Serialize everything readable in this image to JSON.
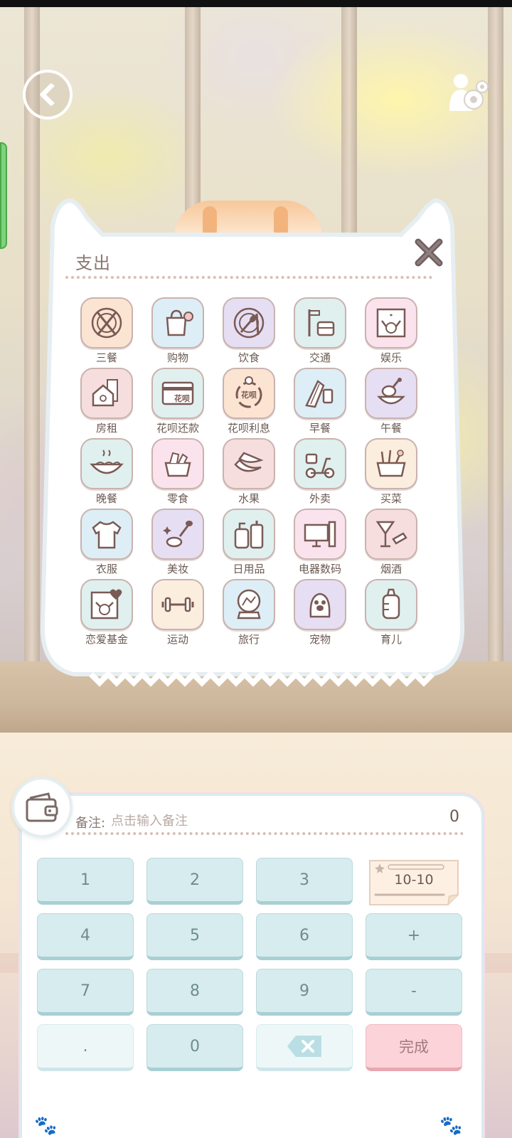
{
  "panel": {
    "title": "支出",
    "categories": [
      {
        "label": "三餐",
        "icon": "plate-fork-knife-icon",
        "color": "peach"
      },
      {
        "label": "购物",
        "icon": "shopping-bag-icon",
        "color": "blue"
      },
      {
        "label": "饮食",
        "icon": "plate-spoon-icon",
        "color": "lav"
      },
      {
        "label": "交通",
        "icon": "bus-stop-icon",
        "color": "mint"
      },
      {
        "label": "娱乐",
        "icon": "duck-picture-icon",
        "color": "pink"
      },
      {
        "label": "房租",
        "icon": "house-icon",
        "color": "rose"
      },
      {
        "label": "花呗还款",
        "icon": "credit-card-icon",
        "color": "mint",
        "text": "花呗"
      },
      {
        "label": "花呗利息",
        "icon": "interest-cycle-icon",
        "color": "peach",
        "text": "花呗"
      },
      {
        "label": "早餐",
        "icon": "sandwich-icon",
        "color": "blue"
      },
      {
        "label": "午餐",
        "icon": "drumstick-icon",
        "color": "lav"
      },
      {
        "label": "晚餐",
        "icon": "noodle-bowl-icon",
        "color": "mint"
      },
      {
        "label": "零食",
        "icon": "snack-basket-icon",
        "color": "pink"
      },
      {
        "label": "水果",
        "icon": "banana-icon",
        "color": "rose"
      },
      {
        "label": "外卖",
        "icon": "delivery-scooter-icon",
        "color": "mint"
      },
      {
        "label": "买菜",
        "icon": "vegetable-basket-icon",
        "color": "cream"
      },
      {
        "label": "衣服",
        "icon": "shirt-icon",
        "color": "blue"
      },
      {
        "label": "美妆",
        "icon": "makeup-brush-icon",
        "color": "lav"
      },
      {
        "label": "日用品",
        "icon": "toiletries-icon",
        "color": "mint"
      },
      {
        "label": "电器数码",
        "icon": "computer-icon",
        "color": "pink"
      },
      {
        "label": "烟酒",
        "icon": "cocktail-cigarette-icon",
        "color": "rose"
      },
      {
        "label": "恋爱基金",
        "icon": "heart-duck-icon",
        "color": "mint"
      },
      {
        "label": "运动",
        "icon": "dumbbell-icon",
        "color": "cream"
      },
      {
        "label": "旅行",
        "icon": "snow-globe-icon",
        "color": "blue"
      },
      {
        "label": "宠物",
        "icon": "paw-icon",
        "color": "lav"
      },
      {
        "label": "育儿",
        "icon": "baby-bottle-icon",
        "color": "mint"
      }
    ]
  },
  "entry": {
    "memo_label": "备注:",
    "memo_placeholder": "点击输入备注",
    "amount": "0",
    "date": "10-10"
  },
  "keys": {
    "k1": "1",
    "k2": "2",
    "k3": "3",
    "k4": "4",
    "k5": "5",
    "k6": "6",
    "plus": "+",
    "k7": "7",
    "k8": "8",
    "k9": "9",
    "minus": "-",
    "dot": ".",
    "k0": "0",
    "done": "完成"
  },
  "icons": {
    "back": "back-chevron-icon",
    "settings": "user-gear-icon",
    "close": "close-icon",
    "wallet": "wallet-icon",
    "backspace": "backspace-icon"
  },
  "colors": {
    "ink": "#6b5a53",
    "key": "#d7ecee",
    "done": "#fcd3d8"
  }
}
